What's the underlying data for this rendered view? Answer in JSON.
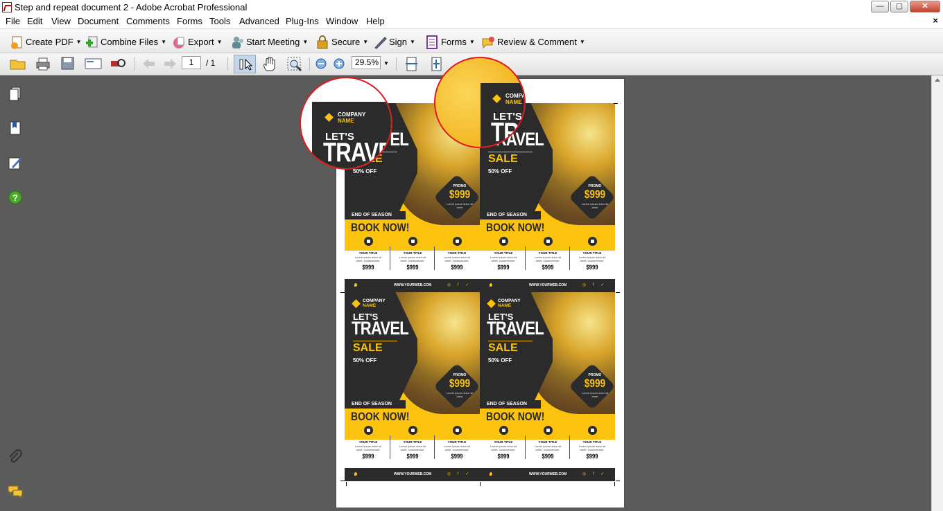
{
  "window": {
    "title": "Step and repeat document 2 - Adobe Acrobat Professional",
    "minimize": "—",
    "maximize": "▢",
    "close": "✕"
  },
  "menu": [
    "File",
    "Edit",
    "View",
    "Document",
    "Comments",
    "Forms",
    "Tools",
    "Advanced",
    "Plug-Ins",
    "Window",
    "Help"
  ],
  "menu_close": "×",
  "tasks": [
    {
      "label": "Create PDF",
      "icon": "create-pdf-icon"
    },
    {
      "label": "Combine Files",
      "icon": "combine-files-icon"
    },
    {
      "label": "Export",
      "icon": "export-icon"
    },
    {
      "label": "Start Meeting",
      "icon": "start-meeting-icon"
    },
    {
      "label": "Secure",
      "icon": "lock-icon"
    },
    {
      "label": "Sign",
      "icon": "pen-icon"
    },
    {
      "label": "Forms",
      "icon": "forms-icon"
    },
    {
      "label": "Review & Comment",
      "icon": "review-comment-icon"
    }
  ],
  "toolbar": {
    "page_current": "1",
    "page_total": "/ 1",
    "zoom": "29.5%"
  },
  "colors": {
    "accent": "#fbc30f",
    "dark": "#2b2b2b",
    "magnifier": "#e0191b"
  },
  "flyer": {
    "company_line1": "COMPANY",
    "company_line2": "NAME",
    "lets": "LET'S",
    "travel": "TRAVEL",
    "sale": "SALE",
    "off": "50% OFF",
    "promo": "PROMO",
    "price": "$999",
    "promo_sub": "Lorem ipsum dolor sit amet",
    "end_of_season": "END OF SEASON",
    "book_now": "BOOK NOW!",
    "columns": [
      {
        "icon": "plane-icon",
        "title": "YOUR TITLE",
        "text": "Lorem ipsum dolor sit amet, consectetuer.",
        "price": "$999"
      },
      {
        "icon": "location-pin-icon",
        "title": "YOUR TITLE",
        "text": "Lorem ipsum dolor sit amet, consectetuer.",
        "price": "$999"
      },
      {
        "icon": "camera-icon",
        "title": "YOUR TITLE",
        "text": "Lorem ipsum dolor sit amet, consectetuer.",
        "price": "$999"
      }
    ],
    "website": "WWW.YOURWEB.COM",
    "social": "◎ f ✓"
  }
}
